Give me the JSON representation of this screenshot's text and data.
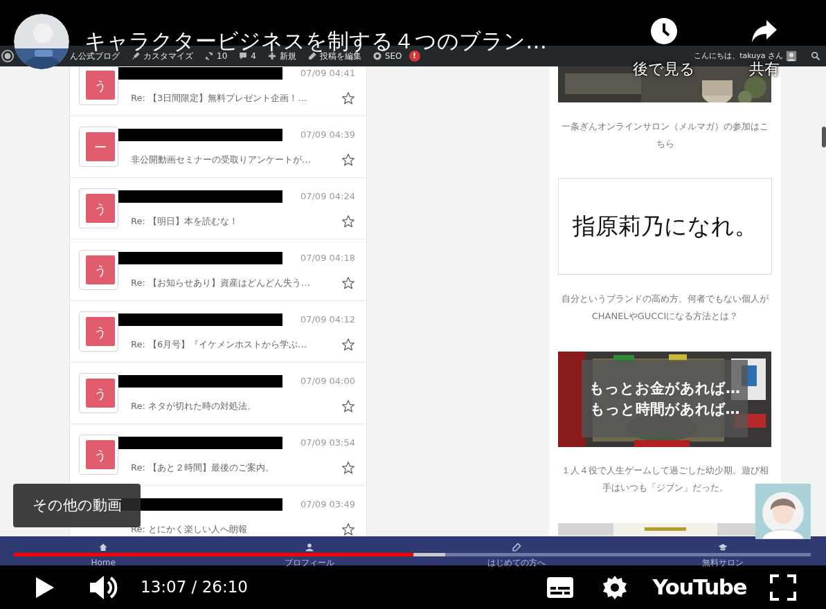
{
  "video": {
    "title": "キャラクタービジネスを制する４つのブラン…",
    "actions": [
      {
        "kind": "watch_later",
        "label": "後で見る"
      },
      {
        "kind": "share",
        "label": "共有"
      }
    ],
    "more_videos": "その他の動画"
  },
  "screen_recording": {
    "admin_bar": {
      "items": [
        {
          "kind": "site",
          "label": "ん公式ブログ"
        },
        {
          "kind": "customize",
          "label": "カスタマイズ"
        },
        {
          "kind": "updates",
          "label": "10"
        },
        {
          "kind": "comments",
          "label": "4"
        },
        {
          "kind": "new",
          "label": "新規"
        },
        {
          "kind": "edit",
          "label": "投稿を編集"
        },
        {
          "kind": "seo",
          "label": "SEO",
          "badge": "!"
        }
      ],
      "greeting": "こんにちは、takuya さん"
    },
    "messages": [
      {
        "initial": "う",
        "time": "07/09 04:41",
        "subject": "Re: 【3日間限定】無料プレゼント企画！…",
        "starred": false
      },
      {
        "initial": "ー",
        "time": "07/09 04:39",
        "subject": "非公開動画セミナーの受取りアンケートが…",
        "starred": false
      },
      {
        "initial": "う",
        "time": "07/09 04:24",
        "subject": "Re: 【明日】本を読むな！",
        "starred": false
      },
      {
        "initial": "う",
        "time": "07/09 04:18",
        "subject": "Re: 【お知らせあり】資産はどんどん失う…",
        "starred": false
      },
      {
        "initial": "う",
        "time": "07/09 04:12",
        "subject": "Re: 【6月号】『イケメンホストから学ぶ…",
        "starred": false
      },
      {
        "initial": "う",
        "time": "07/09 04:00",
        "subject": "Re: ネタが切れた時の対処法。",
        "starred": false
      },
      {
        "initial": "う",
        "time": "07/09 03:54",
        "subject": "Re: 【あと２時間】最後のご案内。",
        "starred": false
      },
      {
        "time": "07/09 03:49",
        "subject": "Re: とにかく楽しい人へ朗報",
        "starred": false
      }
    ],
    "sidebar": [
      {
        "kind": "banner",
        "caption_lines": [
          "一条ぎんオンラインサロン（メルマガ）の参加はこ",
          "ちら"
        ]
      },
      {
        "kind": "headline_card",
        "headline": "指原莉乃になれ。",
        "caption_lines": [
          "自分というブランドの高め方。何者でもない個人が",
          "CHANELやGUCCIになる方法とは？"
        ]
      },
      {
        "kind": "photo_card",
        "overlay": [
          "もっとお金があれば…",
          "もっと時間があれば…"
        ],
        "caption_lines": [
          "１人４役で人生ゲームして過ごした幼少期。遊び相",
          "手はいつも「ジブン」だった。"
        ]
      },
      {
        "kind": "picture"
      }
    ],
    "site_nav": [
      {
        "kind": "home",
        "label": "Home"
      },
      {
        "kind": "profile",
        "label": "プロフィール"
      },
      {
        "kind": "guide",
        "label": "はじめての方へ"
      },
      {
        "kind": "salon",
        "label": "無料サロン"
      }
    ]
  },
  "player": {
    "progress": {
      "level": 0.501
    },
    "buffer": {
      "level": 0.541
    },
    "playing": false,
    "time": "13:07 / 26:10",
    "logo": "YouTube"
  }
}
